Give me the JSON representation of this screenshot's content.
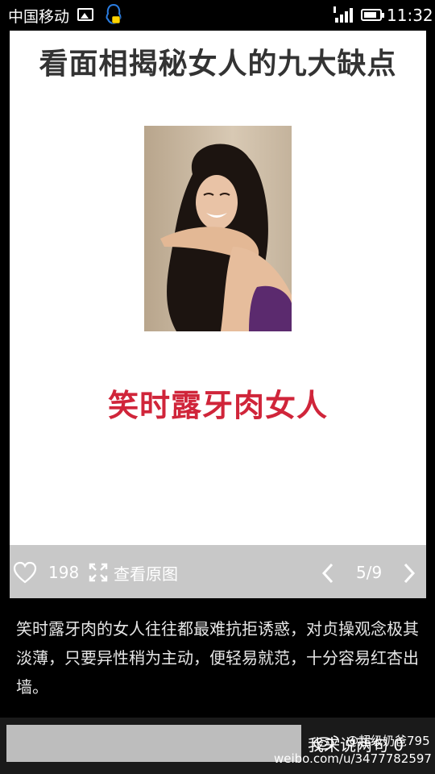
{
  "status_bar": {
    "carrier": "中国移动",
    "time": "11:32"
  },
  "article": {
    "title": "看面相揭秘女人的九大缺点",
    "caption": "笑时露牙肉女人",
    "description": "笑时露牙肉的女人往往都最难抗拒诱惑，对贞操观念极其淡薄，只要异性稍为主动，便轻易就范，十分容易红杏出墙。"
  },
  "action_bar": {
    "like_count": "198",
    "view_original_label": "查看原图",
    "page_indicator": "5/9"
  },
  "comment_bar": {
    "input_placeholder": "",
    "comment_button_label": "我来说两句 0"
  },
  "watermark": {
    "user": "@超级奶爸795",
    "url": "weibo.com/u/3477782597"
  },
  "colors": {
    "caption_red": "#d0253a",
    "action_bar_gray": "#c8c8c8"
  }
}
